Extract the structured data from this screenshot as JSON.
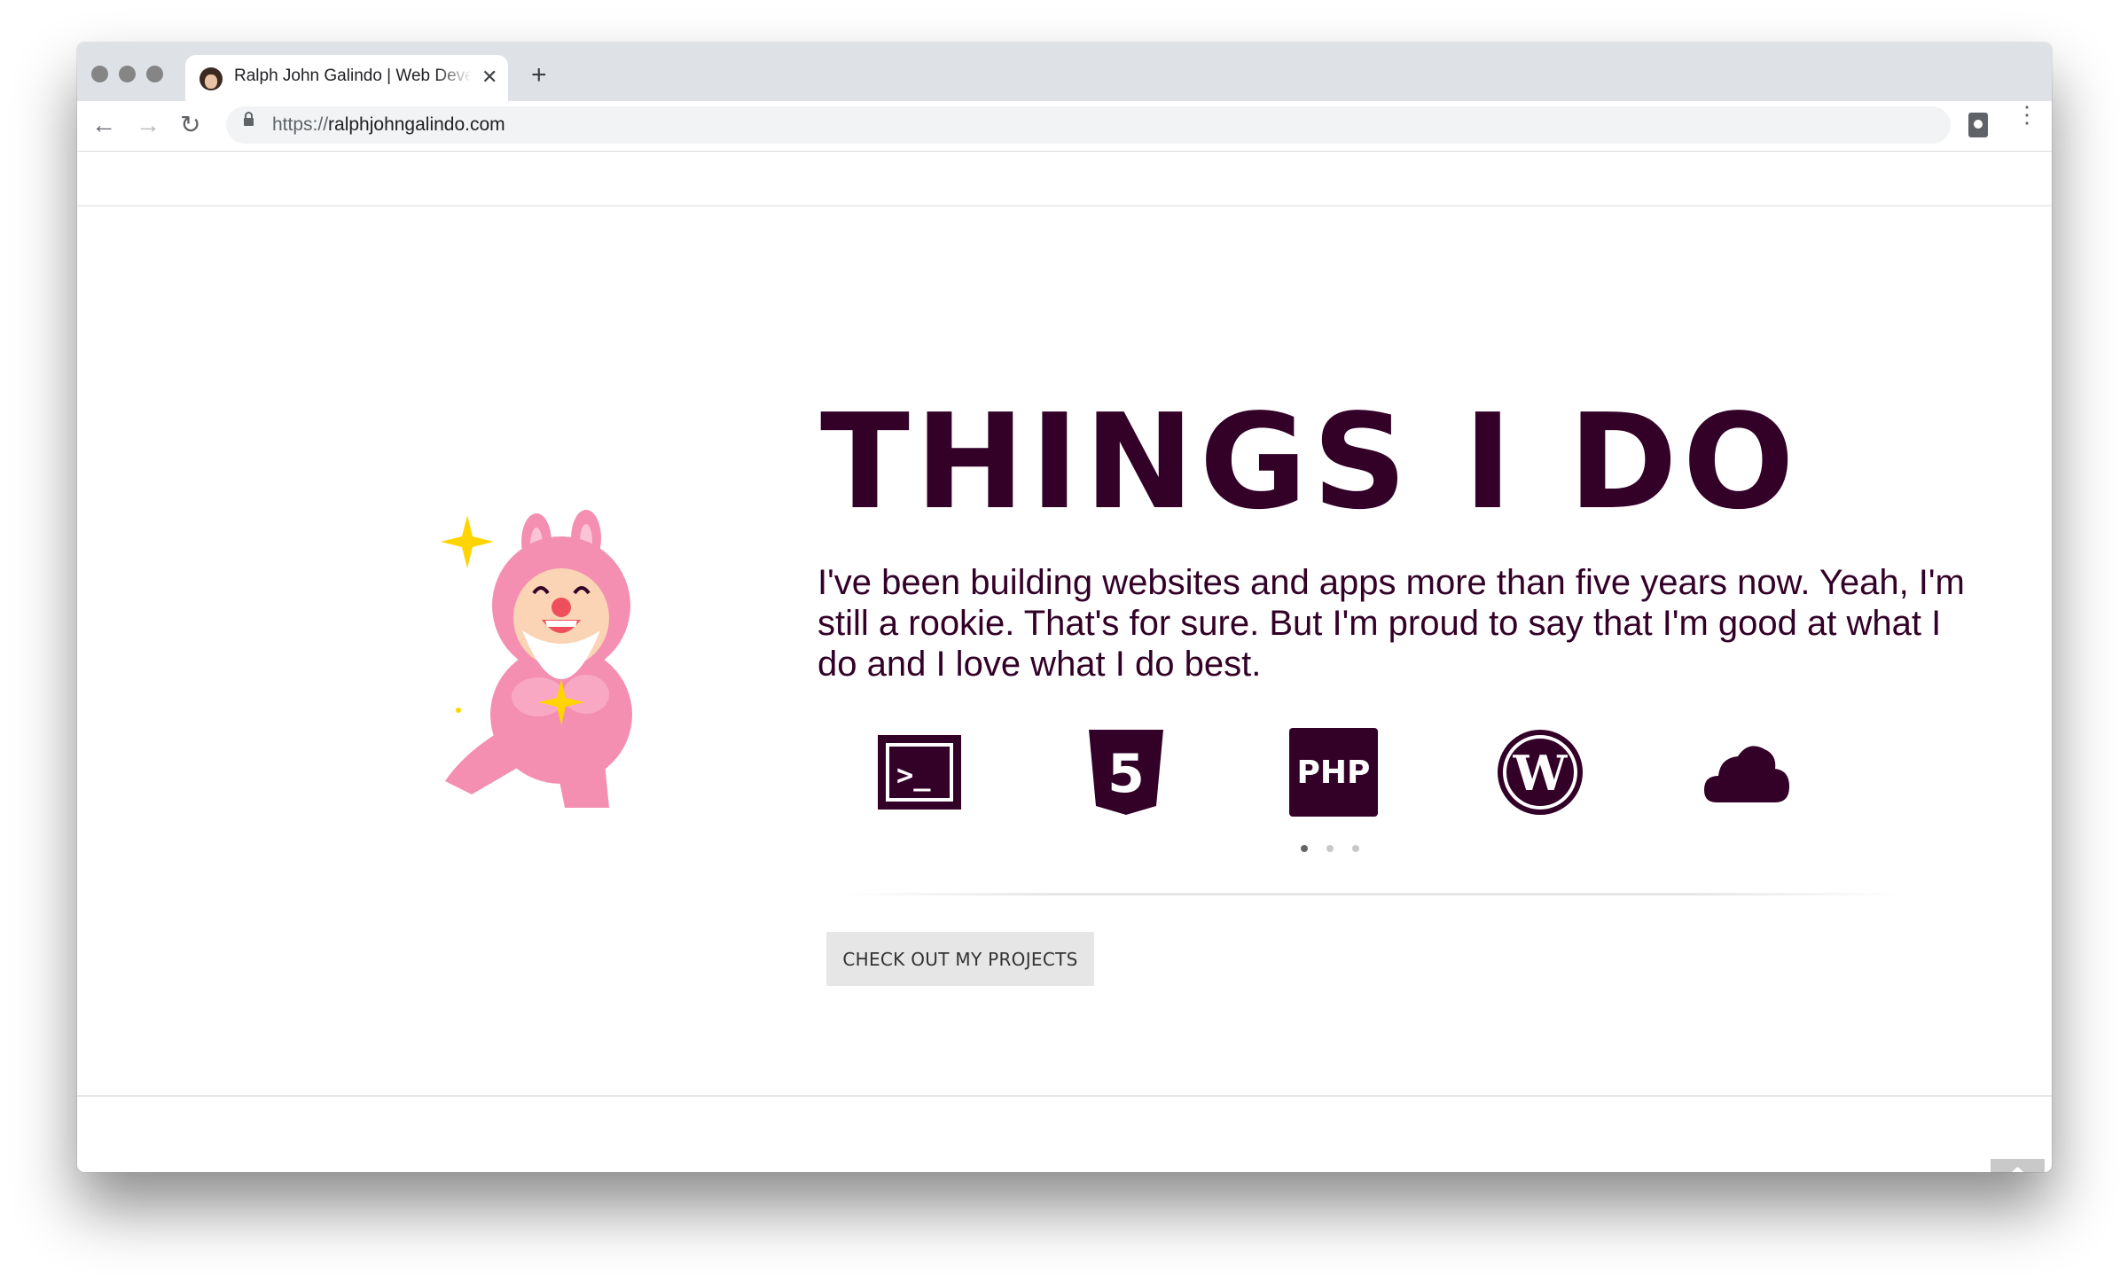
{
  "browser": {
    "tab": {
      "title": "Ralph John Galindo | Web Developer",
      "close_glyph": "✕"
    },
    "new_tab_glyph": "+",
    "nav": {
      "back_glyph": "←",
      "forward_glyph": "→",
      "reload_glyph": "↻"
    },
    "address": {
      "scheme": "https://",
      "host": "ralphjohngalindo.com"
    },
    "menu_glyph": "⋮"
  },
  "page": {
    "headline": "THINGS I DO",
    "intro": "I've been building websites and apps more than five years now. Yeah, I'm still a rookie. That's for sure. But I'm proud to say that I'm good at what I do and I love what I do best.",
    "skills": [
      {
        "icon": "terminal-icon",
        "label": ">_"
      },
      {
        "icon": "html5-icon",
        "label": "5"
      },
      {
        "icon": "php-icon",
        "label": "PHP"
      },
      {
        "icon": "wordpress-icon",
        "label": "W"
      },
      {
        "icon": "cloud-icon"
      }
    ],
    "carousel": {
      "pages": 3,
      "active": 1
    },
    "cta_label": "CHECK OUT MY PROJECTS",
    "mascot_icon": "pink-bunny-mascot",
    "scroll_top_icon": "chevron-double-up-icon"
  },
  "colors": {
    "brand": "#330028",
    "mascot_pink": "#f48fb1",
    "sparkle": "#ffd400",
    "button_bg": "#e6e6e6"
  }
}
